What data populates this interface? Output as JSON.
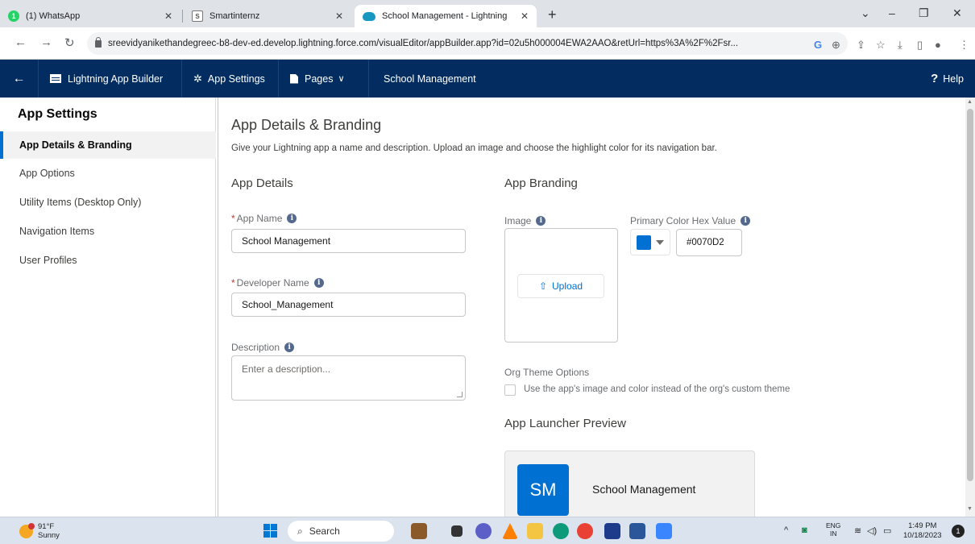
{
  "browser": {
    "tabs": [
      {
        "title": "(1) WhatsApp",
        "badge": "1"
      },
      {
        "title": "Smartinternz",
        "badge": ""
      },
      {
        "title": "School Management - Lightning",
        "badge": ""
      }
    ],
    "url": "sreevidyanikethandegreec-b8-dev-ed.develop.lightning.force.com/visualEditor/appBuilder.app?id=02u5h000004EWA2AAO&retUrl=https%3A%2F%2Fsr..."
  },
  "header": {
    "builder_label": "Lightning App Builder",
    "app_settings_label": "App Settings",
    "pages_label": "Pages",
    "app_name": "School Management",
    "help_label": "Help"
  },
  "sidebar": {
    "title": "App Settings",
    "items": [
      {
        "label": "App Details & Branding"
      },
      {
        "label": "App Options"
      },
      {
        "label": "Utility Items (Desktop Only)"
      },
      {
        "label": "Navigation Items"
      },
      {
        "label": "User Profiles"
      }
    ]
  },
  "main": {
    "title": "App Details & Branding",
    "description": "Give your Lightning app a name and description. Upload an image and choose the highlight color for its navigation bar.",
    "details_heading": "App Details",
    "app_name_label": "App Name",
    "app_name_value": "School Management",
    "dev_name_label": "Developer Name",
    "dev_name_value": "School_Management",
    "description_label": "Description",
    "description_placeholder": "Enter a description...",
    "branding_heading": "App Branding",
    "image_label": "Image",
    "upload_label": "Upload",
    "color_label": "Primary Color Hex Value",
    "color_value": "#0070D2",
    "org_theme_label": "Org Theme Options",
    "org_theme_checkbox": "Use the app's image and color instead of the org's custom theme",
    "launcher_heading": "App Launcher Preview",
    "launcher_initials": "SM",
    "launcher_name": "School Management"
  },
  "taskbar": {
    "temperature": "91°F",
    "condition": "Sunny",
    "search_label": "Search",
    "lang_top": "ENG",
    "lang_bottom": "IN",
    "time": "1:49 PM",
    "date": "10/18/2023",
    "notifications": "1"
  },
  "colors": {
    "sf_navy": "#032d60",
    "brand_blue": "#0070d2"
  }
}
